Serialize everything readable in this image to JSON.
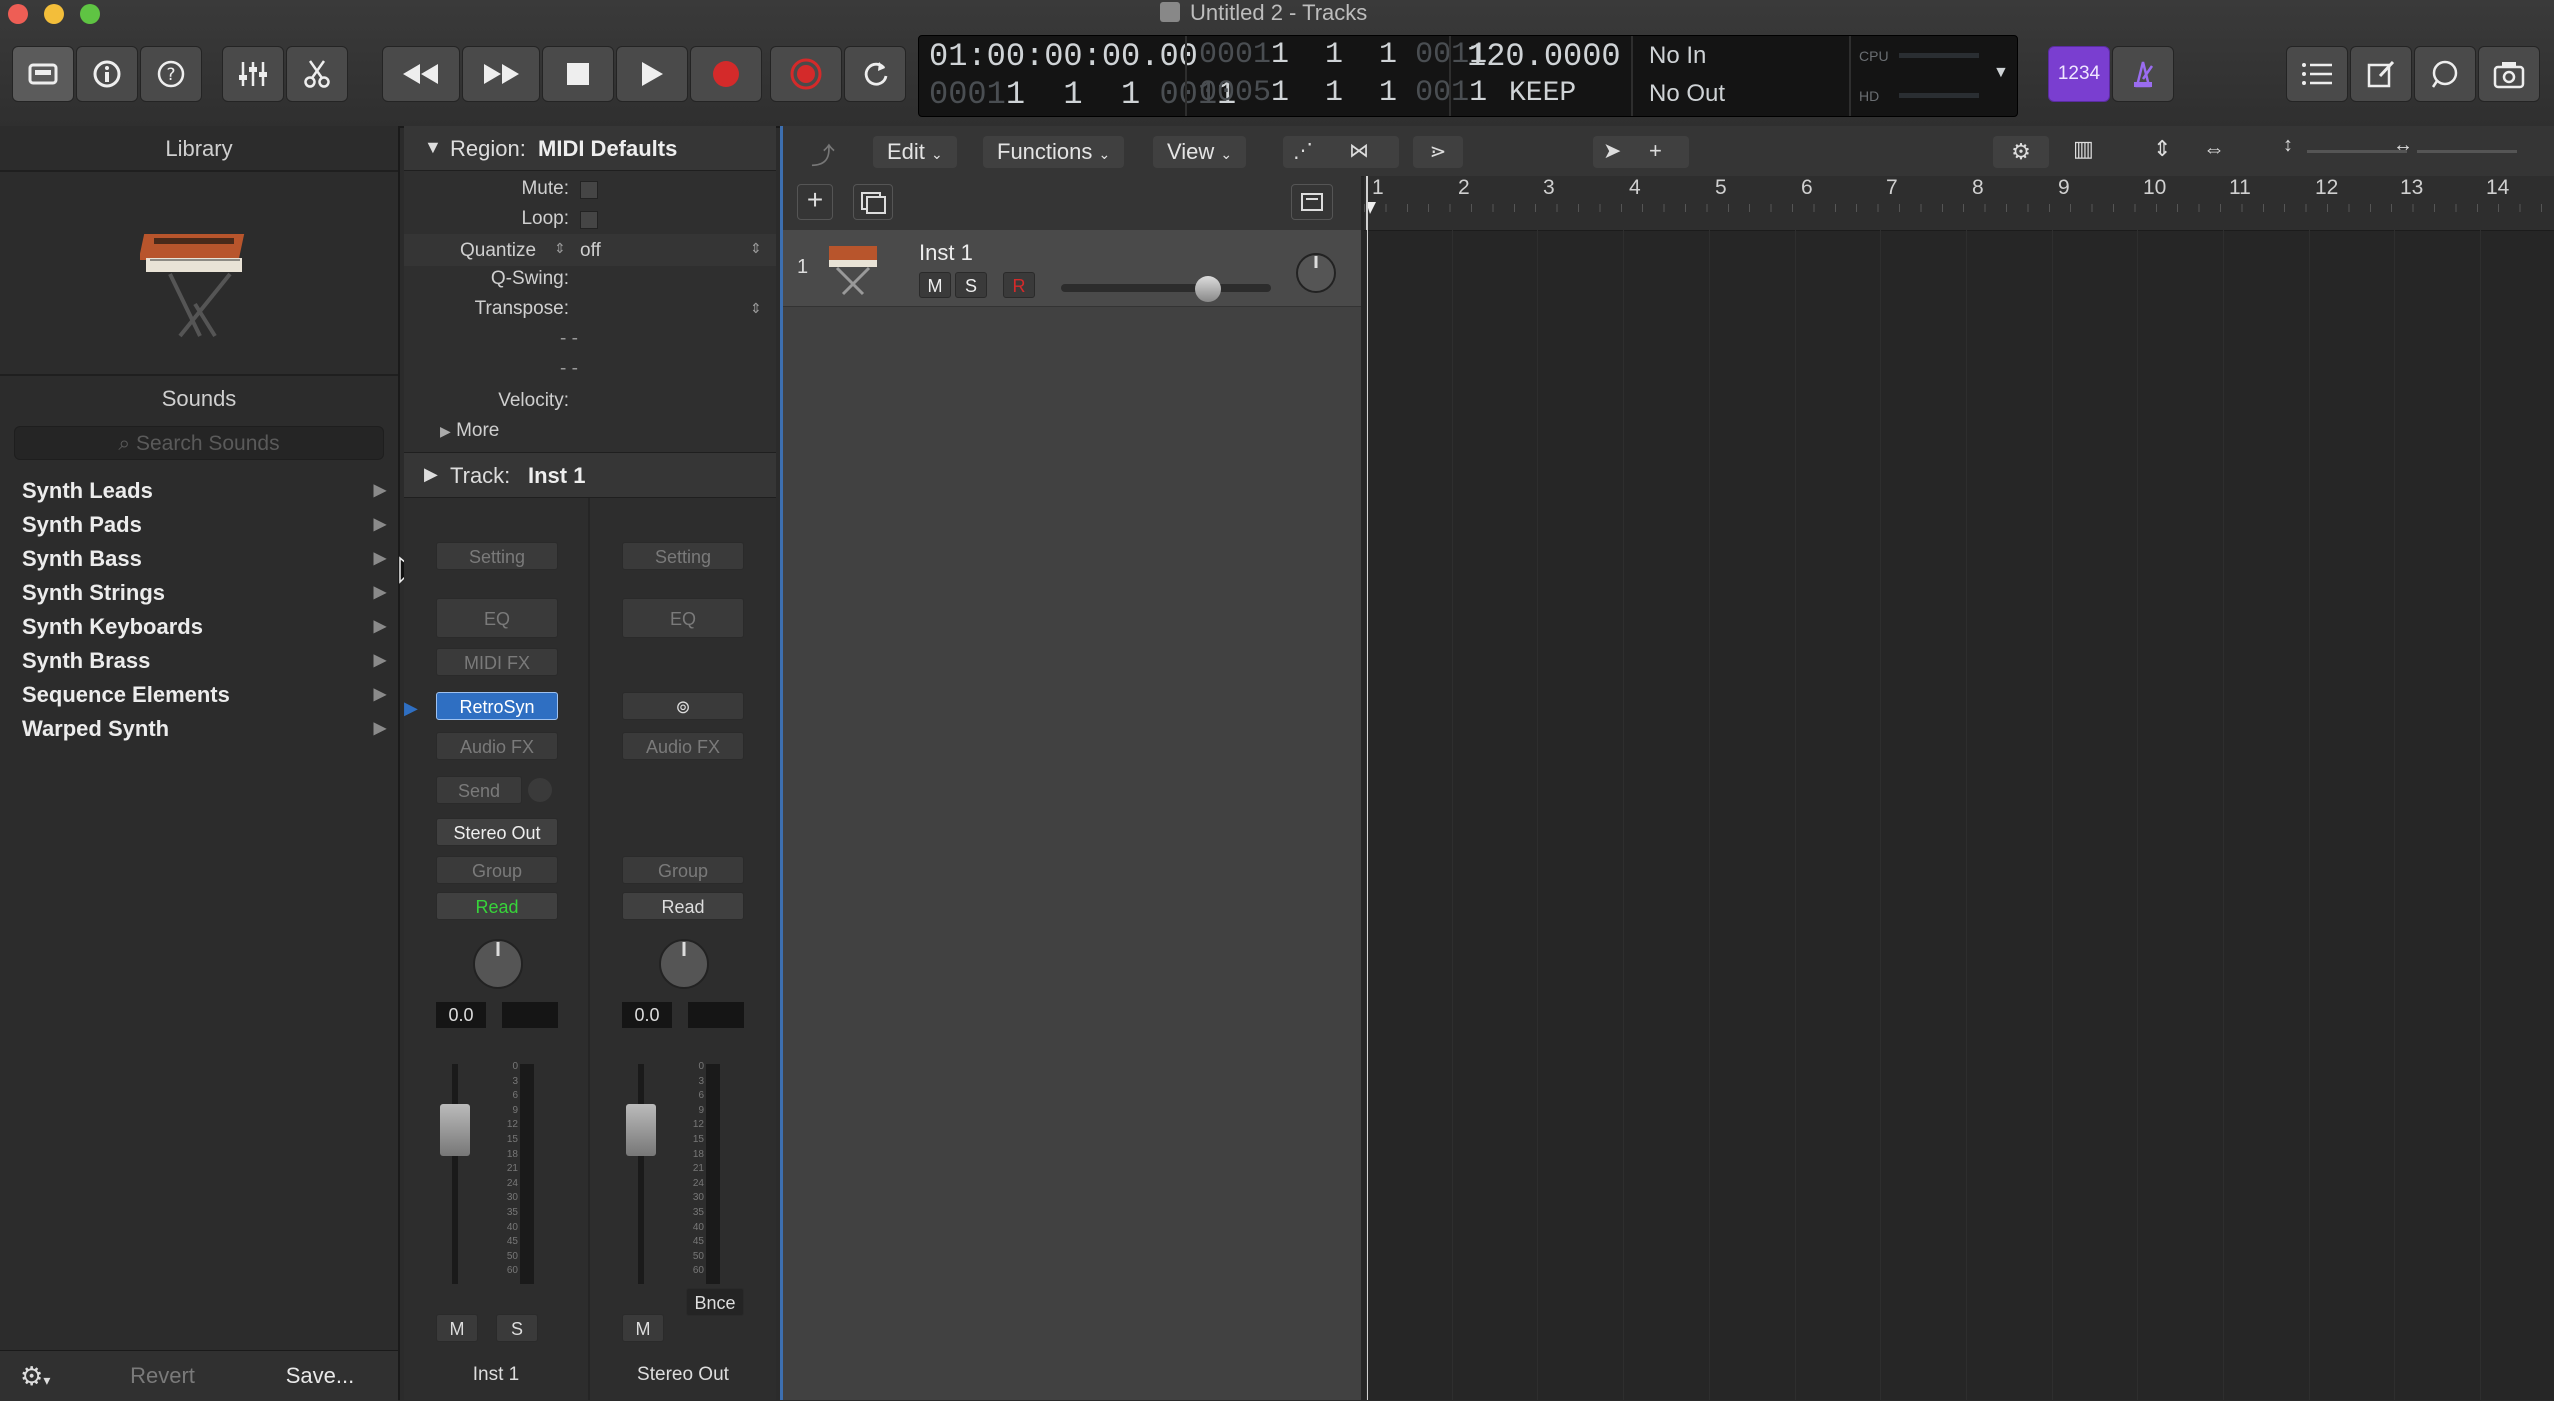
{
  "window": {
    "title": "Untitled 2 - Tracks"
  },
  "transport": {
    "time": "01:00:00:00.00",
    "bars_top_dim": "0001",
    "bars_top": "1  1  1",
    "bars_top_dim2": "001",
    "bars_top_last": "1",
    "bars_bottom_dim": "0001",
    "bars_bottom": "1  1  1",
    "bars_bottom_dim2": "001",
    "bars_bottom_last": "1",
    "pos_top_dim": "0001",
    "pos_top": "1  1  1",
    "pos_top_dim2": "001",
    "pos_top_last": "1",
    "pos_bottom_dim": "0005",
    "pos_bottom": "1  1  1",
    "pos_bottom_dim2": "001",
    "pos_bottom_last": "1",
    "tempo": "120.0000",
    "tempo_mode": "KEEP",
    "midi_in": "No In",
    "midi_out": "No Out",
    "cpu_label": "CPU",
    "hd_label": "HD",
    "count_in": "1234"
  },
  "library": {
    "title": "Library",
    "sounds_title": "Sounds",
    "search_placeholder": "Search Sounds",
    "items": [
      {
        "label": "Synth Leads"
      },
      {
        "label": "Synth Pads"
      },
      {
        "label": "Synth Bass"
      },
      {
        "label": "Synth Strings"
      },
      {
        "label": "Synth Keyboards"
      },
      {
        "label": "Synth Brass"
      },
      {
        "label": "Sequence Elements"
      },
      {
        "label": "Warped Synth"
      }
    ],
    "revert_label": "Revert",
    "save_label": "Save..."
  },
  "inspector": {
    "region_label": "Region:",
    "region_name": "MIDI Defaults",
    "mute": "Mute:",
    "loop": "Loop:",
    "quantize": "Quantize",
    "quantize_value": "off",
    "qswing": "Q-Swing:",
    "transpose": "Transpose:",
    "dashes": "- -",
    "velocity": "Velocity:",
    "more": "More",
    "track_label": "Track:",
    "track_name": "Inst 1"
  },
  "strips": [
    {
      "setting": "Setting",
      "eq": "EQ",
      "midi_fx": "MIDI FX",
      "instrument": "RetroSyn",
      "audio_fx": "Audio FX",
      "send": "Send",
      "output": "Stereo Out",
      "group": "Group",
      "automation": "Read",
      "volume": "0.0",
      "mute": "M",
      "solo": "S",
      "name": "Inst 1"
    },
    {
      "setting": "Setting",
      "eq": "EQ",
      "audio_fx": "Audio FX",
      "group": "Group",
      "automation": "Read",
      "volume": "0.0",
      "bounce": "Bnce",
      "mute": "M",
      "name": "Stereo Out"
    }
  ],
  "meter_scale": [
    "0",
    "3",
    "6",
    "9",
    "12",
    "15",
    "18",
    "21",
    "24",
    "30",
    "35",
    "40",
    "45",
    "50",
    "60"
  ],
  "tracks_toolbar": {
    "edit": "Edit",
    "functions": "Functions",
    "view": "View"
  },
  "tracks": [
    {
      "number": "1",
      "name": "Inst 1",
      "mute": "M",
      "solo": "S",
      "record": "R"
    }
  ],
  "ruler": [
    "1",
    "2",
    "3",
    "4",
    "5",
    "6",
    "7",
    "8",
    "9",
    "10",
    "11",
    "12",
    "13",
    "14"
  ],
  "colors": {
    "record": "#d42a2a",
    "automation_read": "#37d43a",
    "selected_plugin": "#2f6fc2",
    "count_in": "#7a3ed0",
    "accent_border": "#3d6fb0"
  }
}
